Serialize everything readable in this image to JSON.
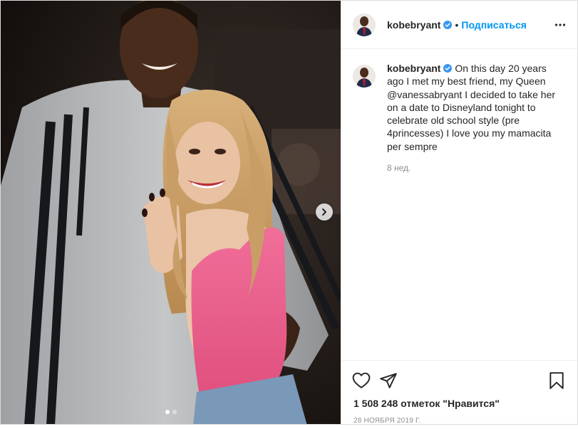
{
  "post": {
    "author": "kobebryant",
    "follow_label": "Подписаться",
    "separator": "•",
    "caption_text": "On this day 20 years ago I met my best friend, my Queen @vanessabryant I decided to take her on a date to Disneyland tonight to celebrate old school style (pre 4princesses) I love you my mamacita per sempre",
    "caption_age": "8 нед.",
    "likes": "1 508 248 отметок \"Нравится\"",
    "date": "28 НОЯБРЯ 2019 Г.",
    "carousel": {
      "total": 2,
      "current": 1
    }
  },
  "icons": {
    "verified": "verified-badge-icon",
    "more": "more-options-icon",
    "like": "heart-icon",
    "share": "paper-plane-icon",
    "save": "bookmark-icon",
    "next": "chevron-right-icon"
  },
  "colors": {
    "link": "#0095f6",
    "verified": "#3897f0",
    "muted": "#8e8e8e",
    "text": "#262626"
  }
}
